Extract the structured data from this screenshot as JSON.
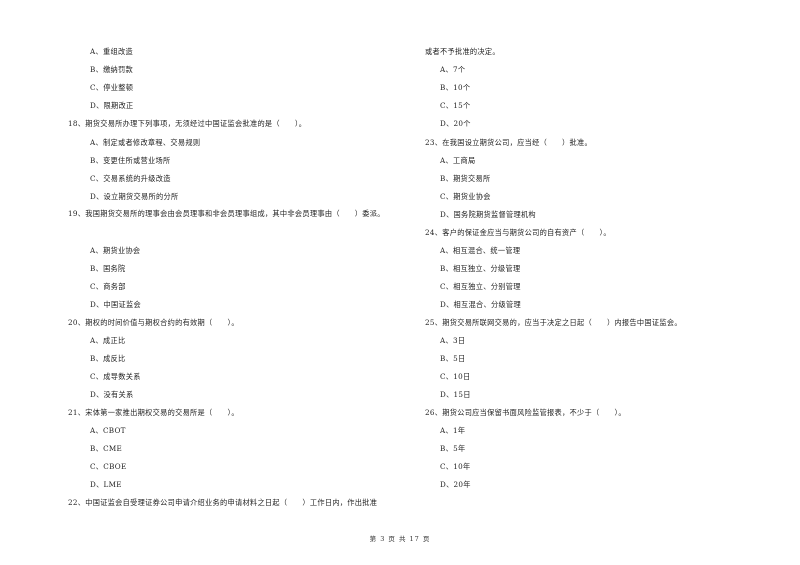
{
  "left_column": {
    "q17_options": [
      "A、重组改造",
      "B、缴纳罚款",
      "C、停业整顿",
      "D、限期改正"
    ],
    "q18": {
      "stem": "18、期货交易所办理下列事项，无须经过中国证监会批准的是（　　）。",
      "options": [
        "A、制定或者修改章程、交易规则",
        "B、变更住所或营业场所",
        "C、交易系统的升级改造",
        "D、设立期货交易所的分所"
      ]
    },
    "q19": {
      "stem": "19、我国期货交易所的理事会由会员理事和非会员理事组成，其中非会员理事由（　　）委派。",
      "options": [
        "A、期货业协会",
        "B、国务院",
        "C、商务部",
        "D、中国证监会"
      ]
    },
    "q20": {
      "stem": "20、期权的时间价值与期权合约的有效期（　　）。",
      "options": [
        "A、成正比",
        "B、成反比",
        "C、成导数关系",
        "D、没有关系"
      ]
    },
    "q21": {
      "stem": "21、宋体第一家推出期权交易的交易所是（　　）。",
      "options": [
        "A、CBOT",
        "B、CME",
        "C、CBOE",
        "D、LME"
      ]
    },
    "q22": {
      "stem": "22、中国证监会自受理证券公司申请介绍业务的申请材料之日起（　　）工作日内，作出批准"
    }
  },
  "right_column": {
    "q22_cont": "或者不予批准的决定。",
    "q22_options": [
      "A、7个",
      "B、10个",
      "C、15个",
      "D、20个"
    ],
    "q23": {
      "stem": "23、在我国设立期货公司，应当经（　　）批准。",
      "options": [
        "A、工商局",
        "B、期货交易所",
        "C、期货业协会",
        "D、国务院期货监督管理机构"
      ]
    },
    "q24": {
      "stem": "24、客户的保证金应当与期货公司的自有资产（　　）。",
      "options": [
        "A、相互混合、统一管理",
        "B、相互独立、分级管理",
        "C、相互独立、分别管理",
        "D、相互混合、分级管理"
      ]
    },
    "q25": {
      "stem": "25、期货交易所联网交易的，应当于决定之日起（　　）内报告中国证监会。",
      "options": [
        "A、3日",
        "B、5日",
        "C、10日",
        "D、15日"
      ]
    },
    "q26": {
      "stem": "26、期货公司应当保留书面风险监管报表，不少于（　　）。",
      "options": [
        "A、1年",
        "B、5年",
        "C、10年",
        "D、20年"
      ]
    }
  },
  "footer": {
    "page_label": "第 3 页 共 17 页"
  }
}
